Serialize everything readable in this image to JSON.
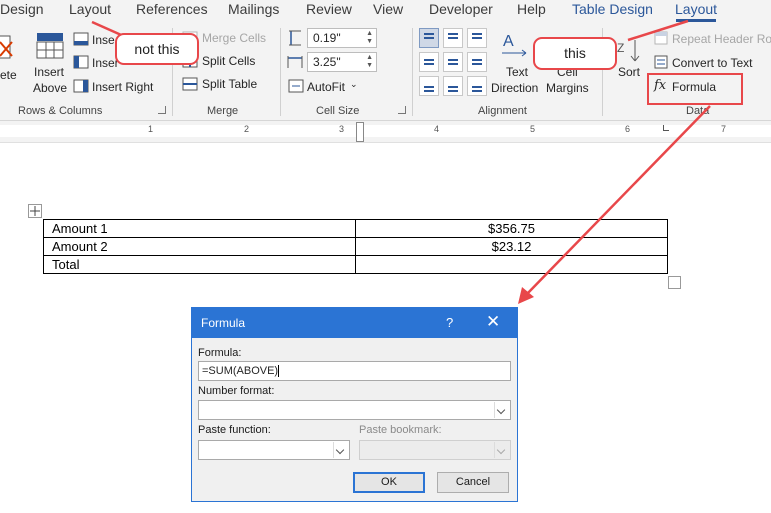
{
  "ribbon": {
    "tabs": [
      {
        "label": "Design"
      },
      {
        "label": "Layout"
      },
      {
        "label": "References"
      },
      {
        "label": "Mailings"
      },
      {
        "label": "Review"
      },
      {
        "label": "View"
      },
      {
        "label": "Developer"
      },
      {
        "label": "Help"
      },
      {
        "label": "Table Design"
      },
      {
        "label": "Layout"
      }
    ],
    "rows_columns": {
      "delete_label": "ete",
      "insert_above_1": "Insert",
      "insert_above_2": "Above",
      "insert_below": "Inse",
      "insert_left": "Inser",
      "insert_right": "Insert Right",
      "group_label": "Rows & Columns"
    },
    "merge": {
      "merge_cells": "Merge Cells",
      "split_cells": "Split Cells",
      "split_table": "Split Table",
      "group_label": "Merge"
    },
    "cell_size": {
      "height_value": "0.19\"",
      "width_value": "3.25\"",
      "autofit_label": "AutoFit",
      "group_label": "Cell Size"
    },
    "alignment": {
      "text_direction_1": "Text",
      "text_direction_2": "Direction",
      "cell_margins_1": "Cell",
      "cell_margins_2": "Margins",
      "group_label": "Alignment"
    },
    "data": {
      "sort_label": "Sort",
      "repeat_header": "Repeat Header Rows",
      "convert_to_text": "Convert to Text",
      "formula_icon": "fx",
      "formula_label": "Formula",
      "group_label": "Data"
    }
  },
  "annotations": {
    "not_this": "not this",
    "this": "this",
    "color": "#e8474a"
  },
  "ruler": {
    "numbers": [
      "1",
      "2",
      "3",
      "4",
      "5",
      "6",
      "7"
    ]
  },
  "document": {
    "table": [
      [
        "Amount 1",
        "$356.75"
      ],
      [
        "Amount 2",
        "$23.12"
      ],
      [
        "Total",
        ""
      ]
    ]
  },
  "dialog": {
    "title": "Formula",
    "help": "?",
    "close": "✕",
    "formula_label": "Formula:",
    "formula_value": "=SUM(ABOVE)",
    "number_format_label": "Number format:",
    "number_format_value": "",
    "paste_function_label": "Paste function:",
    "paste_bookmark_label": "Paste bookmark:",
    "ok": "OK",
    "cancel": "Cancel",
    "accent": "#2b74d4"
  }
}
